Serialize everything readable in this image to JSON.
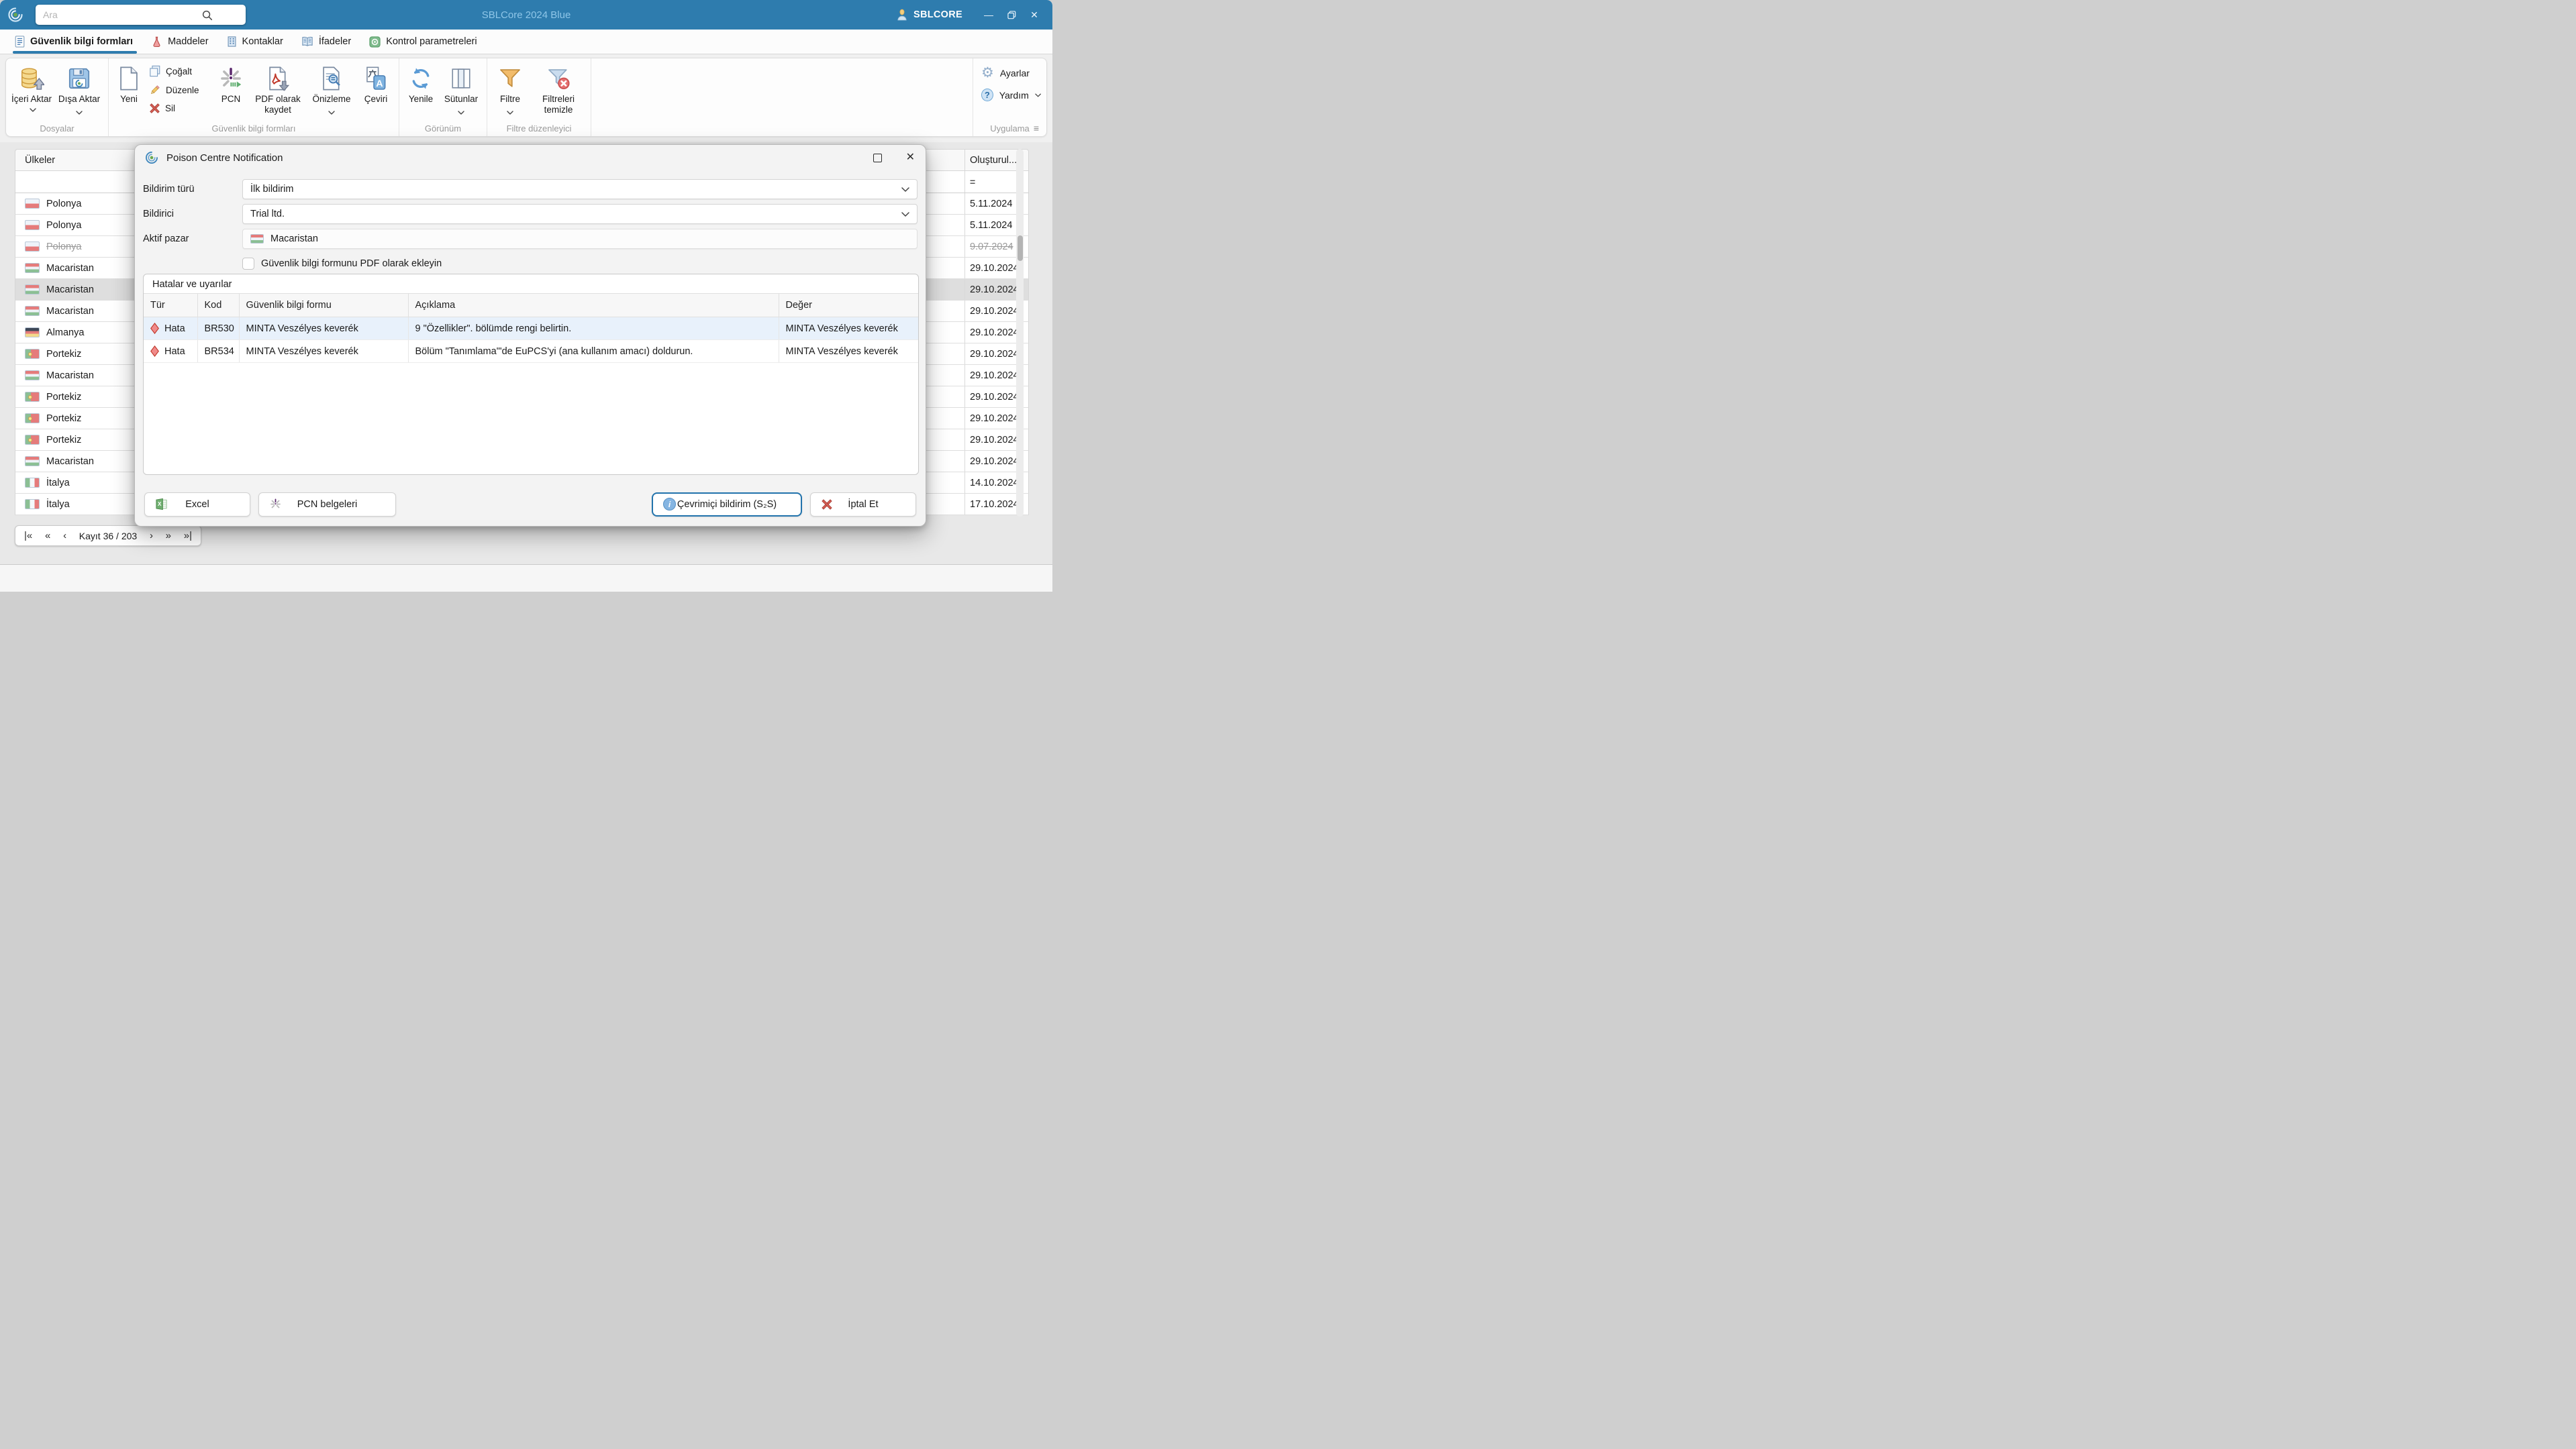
{
  "colors": {
    "titlebar": "#2e7cae",
    "accent": "#2e7cae",
    "selected_row": "#dedede",
    "error_row_selected": "#e8f1fb"
  },
  "icons": {
    "minimize": "—",
    "close": "✕",
    "equals": "=",
    "hamburger": "≡",
    "gear": "⚙",
    "question": "?",
    "info": "i"
  },
  "titlebar": {
    "search_placeholder": "Ara",
    "title": "SBLCore 2024 Blue",
    "account": "SBLCORE"
  },
  "tabs": [
    {
      "label": "Güvenlik bilgi formları",
      "active": true
    },
    {
      "label": "Maddeler",
      "active": false
    },
    {
      "label": "Kontaklar",
      "active": false
    },
    {
      "label": "İfadeler",
      "active": false
    },
    {
      "label": "Kontrol parametreleri",
      "active": false
    }
  ],
  "ribbon": {
    "import_label": "İçeri Aktar",
    "export_label": "Dışa Aktar",
    "files_group": "Dosyalar",
    "new_label": "Yeni",
    "duplicate_label": "Çoğalt",
    "edit_label": "Düzenle",
    "delete_label": "Sil",
    "pcn_label": "PCN",
    "save_pdf_label": "PDF olarak kaydet",
    "preview_label": "Önizleme",
    "translate_label": "Çeviri",
    "sds_group": "Güvenlik bilgi formları",
    "refresh_label": "Yenile",
    "columns_label": "Sütunlar",
    "view_group": "Görünüm",
    "filter_label": "Filtre",
    "clear_filters_label": "Filtreleri temizle",
    "filter_group": "Filtre düzenleyici",
    "settings_label": "Ayarlar",
    "help_label": "Yardım",
    "app_group": "Uygulama"
  },
  "main_table": {
    "country_header": "Ülkeler",
    "created_header": "Oluşturul...",
    "rows": [
      {
        "country": "Polonya",
        "flag": "pl",
        "date": "5.11.2024",
        "deleted": false,
        "selected": false
      },
      {
        "country": "Polonya",
        "flag": "pl",
        "date": "5.11.2024",
        "deleted": false,
        "selected": false
      },
      {
        "country": "Polonya",
        "flag": "pl",
        "date": "9.07.2024",
        "deleted": true,
        "selected": false
      },
      {
        "country": "Macaristan",
        "flag": "hu",
        "date": "29.10.2024",
        "deleted": false,
        "selected": false
      },
      {
        "country": "Macaristan",
        "flag": "hu",
        "date": "29.10.2024",
        "deleted": false,
        "selected": true
      },
      {
        "country": "Macaristan",
        "flag": "hu",
        "date": "29.10.2024",
        "deleted": false,
        "selected": false
      },
      {
        "country": "Almanya",
        "flag": "de",
        "date": "29.10.2024",
        "deleted": false,
        "selected": false
      },
      {
        "country": "Portekiz",
        "flag": "pt",
        "date": "29.10.2024",
        "deleted": false,
        "selected": false
      },
      {
        "country": "Macaristan",
        "flag": "hu",
        "date": "29.10.2024",
        "deleted": false,
        "selected": false
      },
      {
        "country": "Portekiz",
        "flag": "pt",
        "date": "29.10.2024",
        "deleted": false,
        "selected": false
      },
      {
        "country": "Portekiz",
        "flag": "pt",
        "date": "29.10.2024",
        "deleted": false,
        "selected": false
      },
      {
        "country": "Portekiz",
        "flag": "pt",
        "date": "29.10.2024",
        "deleted": false,
        "selected": false
      },
      {
        "country": "Macaristan",
        "flag": "hu",
        "date": "29.10.2024",
        "deleted": false,
        "selected": false
      },
      {
        "country": "İtalya",
        "flag": "it",
        "date": "14.10.2024",
        "deleted": false,
        "selected": false
      },
      {
        "country": "İtalya",
        "flag": "it",
        "date": "17.10.2024",
        "deleted": false,
        "selected": false
      }
    ]
  },
  "pagination": {
    "first": "|«",
    "fast_prev": "«",
    "prev": "‹",
    "label": "Kayıt 36 / 203",
    "next": "›",
    "fast_next": "»",
    "last": "»|"
  },
  "dialog": {
    "title": "Poison Centre Notification",
    "notification_type_label": "Bildirim türü",
    "notification_type_value": "İlk bildirim",
    "notifier_label": "Bildirici",
    "notifier_value": "Trial ltd.",
    "active_market_label": "Aktif pazar",
    "active_market_value": "Macaristan",
    "active_market_flag": "hu",
    "attach_pdf_label": "Güvenlik bilgi formunu PDF olarak ekleyin",
    "attach_pdf_checked": false,
    "errors_title": "Hatalar ve uyarılar",
    "columns": [
      "Tür",
      "Kod",
      "Güvenlik bilgi formu",
      "Açıklama",
      "Değer"
    ],
    "errors": [
      {
        "type": "Hata",
        "code": "BR530",
        "sds": "MINTA Veszélyes keverék",
        "description": "9 \"Özellikler\". bölümde rengi belirtin.",
        "value": "MINTA Veszélyes keverék",
        "selected": true
      },
      {
        "type": "Hata",
        "code": "BR534",
        "sds": "MINTA Veszélyes keverék",
        "description": "Bölüm \"Tanımlama\"'de EuPCS'yi (ana kullanım amacı) doldurun.",
        "value": "MINTA Veszélyes keverék",
        "selected": false
      }
    ],
    "excel_button": "Excel",
    "pcn_documents_button": "PCN belgeleri",
    "online_button": "Çevrimiçi bildirim (S₂S)",
    "cancel_button": "İptal Et"
  }
}
